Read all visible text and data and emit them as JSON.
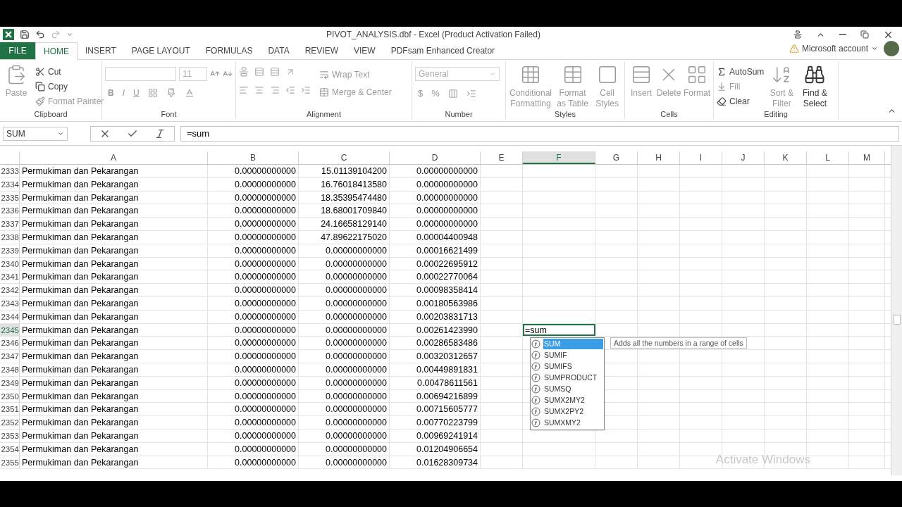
{
  "window": {
    "title": "PIVOT_ANALYSIS.dbf - Excel (Product Activation Failed)"
  },
  "file_tab": "FILE",
  "tabs": [
    {
      "label": "HOME",
      "selected": true
    },
    {
      "label": "INSERT",
      "selected": false
    },
    {
      "label": "PAGE LAYOUT",
      "selected": false
    },
    {
      "label": "FORMULAS",
      "selected": false
    },
    {
      "label": "DATA",
      "selected": false
    },
    {
      "label": "REVIEW",
      "selected": false
    },
    {
      "label": "VIEW",
      "selected": false
    },
    {
      "label": "PDFsam Enhanced Creator",
      "selected": false
    }
  ],
  "account": "Microsoft account",
  "ribbon": [
    {
      "kind": "clipboard",
      "label": "Clipboard",
      "paste": "Paste",
      "cut": "Cut",
      "copy": "Copy",
      "format_painter": "Format Painter"
    },
    {
      "kind": "font",
      "label": "Font",
      "font_size": "11",
      "styles": [
        "B",
        "I",
        "U"
      ]
    },
    {
      "kind": "alignment",
      "label": "Alignment",
      "wrap": "Wrap Text",
      "merge": "Merge & Center"
    },
    {
      "kind": "number",
      "label": "Number",
      "format": "General",
      "currency": "$",
      "percent": "%"
    },
    {
      "kind": "styles",
      "label": "Styles",
      "buttons": [
        "Conditional Formatting",
        "Format as Table",
        "Cell Styles"
      ]
    },
    {
      "kind": "cells",
      "label": "Cells",
      "buttons": [
        "Insert",
        "Delete",
        "Format"
      ]
    },
    {
      "kind": "editing",
      "label": "Editing",
      "autosum": "AutoSum",
      "fill": "Fill",
      "clear": "Clear",
      "sort": "Sort & Filter",
      "find": "Find & Select"
    }
  ],
  "formula_bar": {
    "name_box": "SUM",
    "formula": "=sum"
  },
  "columns": [
    {
      "label": "A",
      "selected": false
    },
    {
      "label": "B",
      "selected": false
    },
    {
      "label": "C",
      "selected": false
    },
    {
      "label": "D",
      "selected": false
    },
    {
      "label": "E",
      "selected": false
    },
    {
      "label": "F",
      "selected": true
    },
    {
      "label": "G",
      "selected": false
    },
    {
      "label": "H",
      "selected": false
    },
    {
      "label": "I",
      "selected": false
    },
    {
      "label": "J",
      "selected": false
    },
    {
      "label": "K",
      "selected": false
    },
    {
      "label": "L",
      "selected": false
    },
    {
      "label": "M",
      "selected": false
    }
  ],
  "rows": [
    {
      "number": "2333",
      "selected": false,
      "a": "Permukiman dan Pekarangan",
      "b": "0.00000000000",
      "c": "15.01139104200",
      "d": "0.00000000000"
    },
    {
      "number": "2334",
      "selected": false,
      "a": "Permukiman dan Pekarangan",
      "b": "0.00000000000",
      "c": "16.76018413580",
      "d": "0.00000000000"
    },
    {
      "number": "2335",
      "selected": false,
      "a": "Permukiman dan Pekarangan",
      "b": "0.00000000000",
      "c": "18.35395474480",
      "d": "0.00000000000"
    },
    {
      "number": "2336",
      "selected": false,
      "a": "Permukiman dan Pekarangan",
      "b": "0.00000000000",
      "c": "18.68001709840",
      "d": "0.00000000000"
    },
    {
      "number": "2337",
      "selected": false,
      "a": "Permukiman dan Pekarangan",
      "b": "0.00000000000",
      "c": "24.16658129140",
      "d": "0.00000000000"
    },
    {
      "number": "2338",
      "selected": false,
      "a": "Permukiman dan Pekarangan",
      "b": "0.00000000000",
      "c": "47.89622175020",
      "d": "0.00004400948"
    },
    {
      "number": "2339",
      "selected": false,
      "a": "Permukiman dan Pekarangan",
      "b": "0.00000000000",
      "c": "0.00000000000",
      "d": "0.00016621499"
    },
    {
      "number": "2340",
      "selected": false,
      "a": "Permukiman dan Pekarangan",
      "b": "0.00000000000",
      "c": "0.00000000000",
      "d": "0.00022695912"
    },
    {
      "number": "2341",
      "selected": false,
      "a": "Permukiman dan Pekarangan",
      "b": "0.00000000000",
      "c": "0.00000000000",
      "d": "0.00022770064"
    },
    {
      "number": "2342",
      "selected": false,
      "a": "Permukiman dan Pekarangan",
      "b": "0.00000000000",
      "c": "0.00000000000",
      "d": "0.00098358414"
    },
    {
      "number": "2343",
      "selected": false,
      "a": "Permukiman dan Pekarangan",
      "b": "0.00000000000",
      "c": "0.00000000000",
      "d": "0.00180563986"
    },
    {
      "number": "2344",
      "selected": false,
      "a": "Permukiman dan Pekarangan",
      "b": "0.00000000000",
      "c": "0.00000000000",
      "d": "0.00203831713"
    },
    {
      "number": "2345",
      "selected": true,
      "a": "Permukiman dan Pekarangan",
      "b": "0.00000000000",
      "c": "0.00000000000",
      "d": "0.00261423990",
      "f": "=sum"
    },
    {
      "number": "2346",
      "selected": false,
      "a": "Permukiman dan Pekarangan",
      "b": "0.00000000000",
      "c": "0.00000000000",
      "d": "0.00286583486"
    },
    {
      "number": "2347",
      "selected": false,
      "a": "Permukiman dan Pekarangan",
      "b": "0.00000000000",
      "c": "0.00000000000",
      "d": "0.00320312657"
    },
    {
      "number": "2348",
      "selected": false,
      "a": "Permukiman dan Pekarangan",
      "b": "0.00000000000",
      "c": "0.00000000000",
      "d": "0.00449891831"
    },
    {
      "number": "2349",
      "selected": false,
      "a": "Permukiman dan Pekarangan",
      "b": "0.00000000000",
      "c": "0.00000000000",
      "d": "0.00478611561"
    },
    {
      "number": "2350",
      "selected": false,
      "a": "Permukiman dan Pekarangan",
      "b": "0.00000000000",
      "c": "0.00000000000",
      "d": "0.00694216899"
    },
    {
      "number": "2351",
      "selected": false,
      "a": "Permukiman dan Pekarangan",
      "b": "0.00000000000",
      "c": "0.00000000000",
      "d": "0.00715605777"
    },
    {
      "number": "2352",
      "selected": false,
      "a": "Permukiman dan Pekarangan",
      "b": "0.00000000000",
      "c": "0.00000000000",
      "d": "0.00770223799"
    },
    {
      "number": "2353",
      "selected": false,
      "a": "Permukiman dan Pekarangan",
      "b": "0.00000000000",
      "c": "0.00000000000",
      "d": "0.00969241914"
    },
    {
      "number": "2354",
      "selected": false,
      "a": "Permukiman dan Pekarangan",
      "b": "0.00000000000",
      "c": "0.00000000000",
      "d": "0.01204906654"
    },
    {
      "number": "2355",
      "selected": false,
      "a": "Permukiman dan Pekarangan",
      "b": "0.00000000000",
      "c": "0.00000000000",
      "d": "0.01628309734"
    }
  ],
  "autocomplete": {
    "items": [
      {
        "label": "SUM",
        "selected": true
      },
      {
        "label": "SUMIF",
        "selected": false
      },
      {
        "label": "SUMIFS",
        "selected": false
      },
      {
        "label": "SUMPRODUCT",
        "selected": false
      },
      {
        "label": "SUMSQ",
        "selected": false
      },
      {
        "label": "SUMX2MY2",
        "selected": false
      },
      {
        "label": "SUMX2PY2",
        "selected": false
      },
      {
        "label": "SUMXMY2",
        "selected": false
      }
    ],
    "tooltip": "Adds all the numbers in a range of cells"
  },
  "activation_notice": "Activate Windows"
}
